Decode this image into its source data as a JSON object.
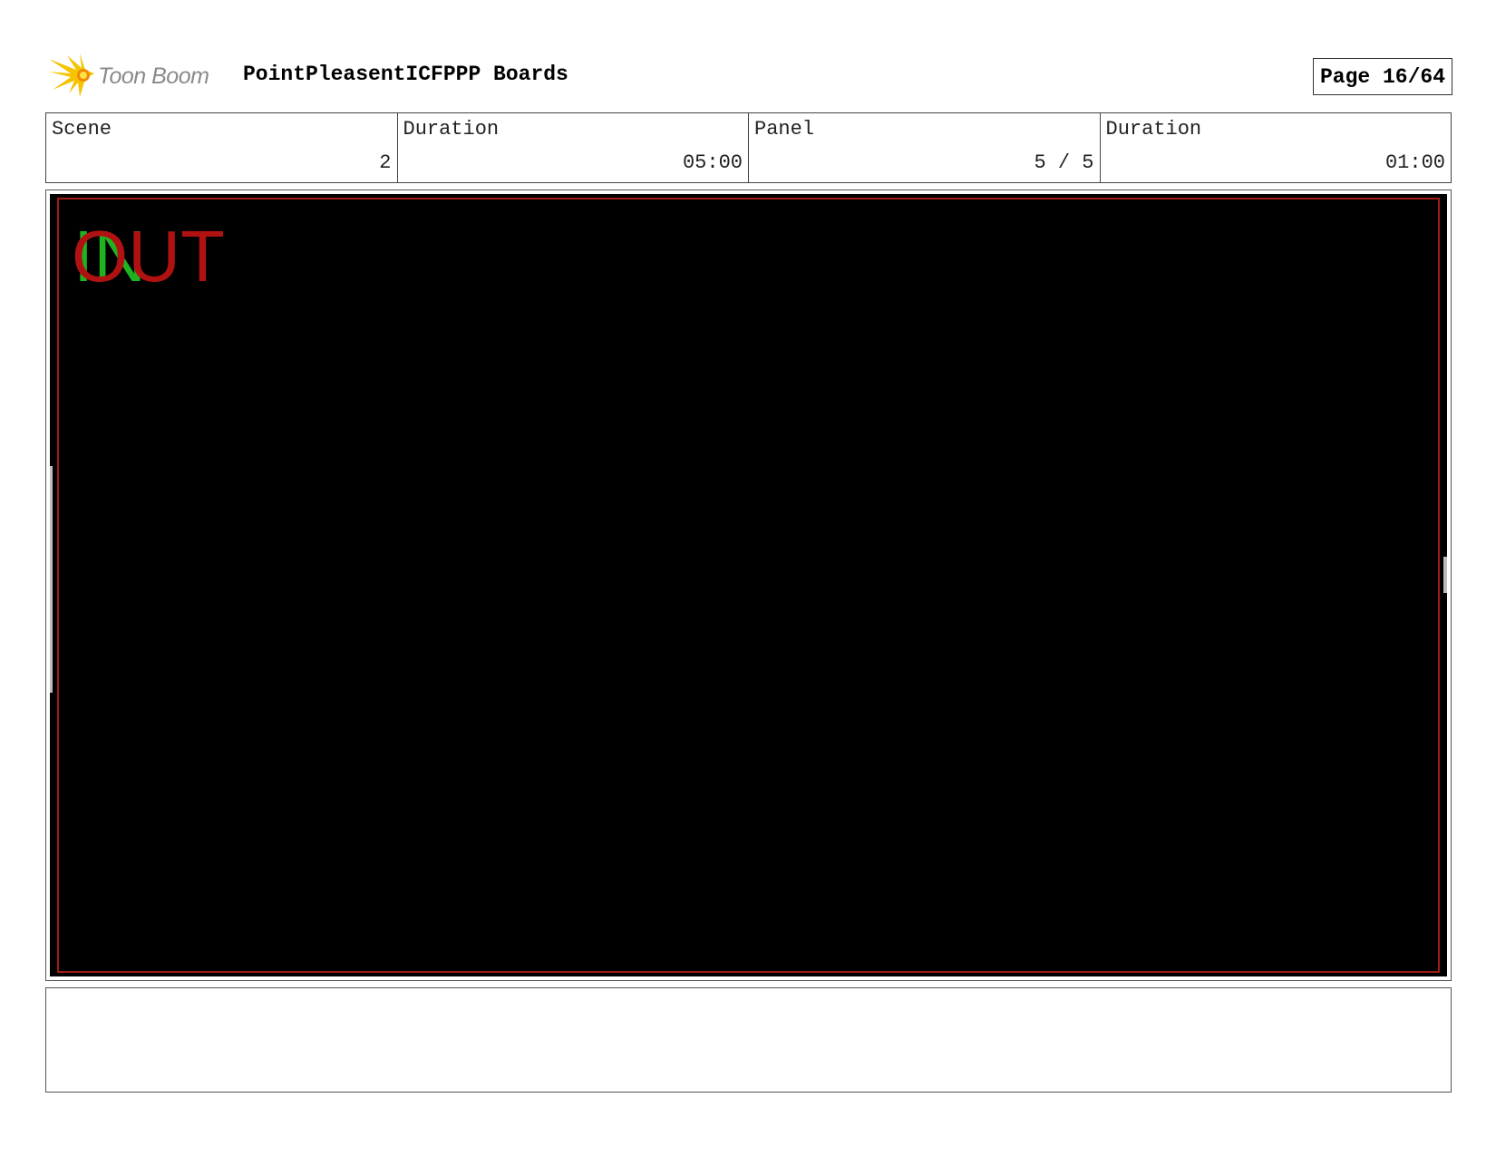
{
  "header": {
    "logo_text": "Toon Boom",
    "project_title": "PointPleasentICFPPP Boards",
    "page_label": "Page 16/64"
  },
  "info": {
    "scene_label": "Scene",
    "scene_value": "2",
    "scene_duration_label": "Duration",
    "scene_duration_value": "05:00",
    "panel_label": "Panel",
    "panel_value": "5 / 5",
    "panel_duration_label": "Duration",
    "panel_duration_value": "01:00"
  },
  "frame": {
    "in_marker": "IN",
    "out_marker": "OUT",
    "colors": {
      "in": "#1fb31f",
      "out": "#b01212",
      "safe_frame": "#a01c14",
      "background": "#000000"
    }
  },
  "notes": {
    "text": ""
  }
}
